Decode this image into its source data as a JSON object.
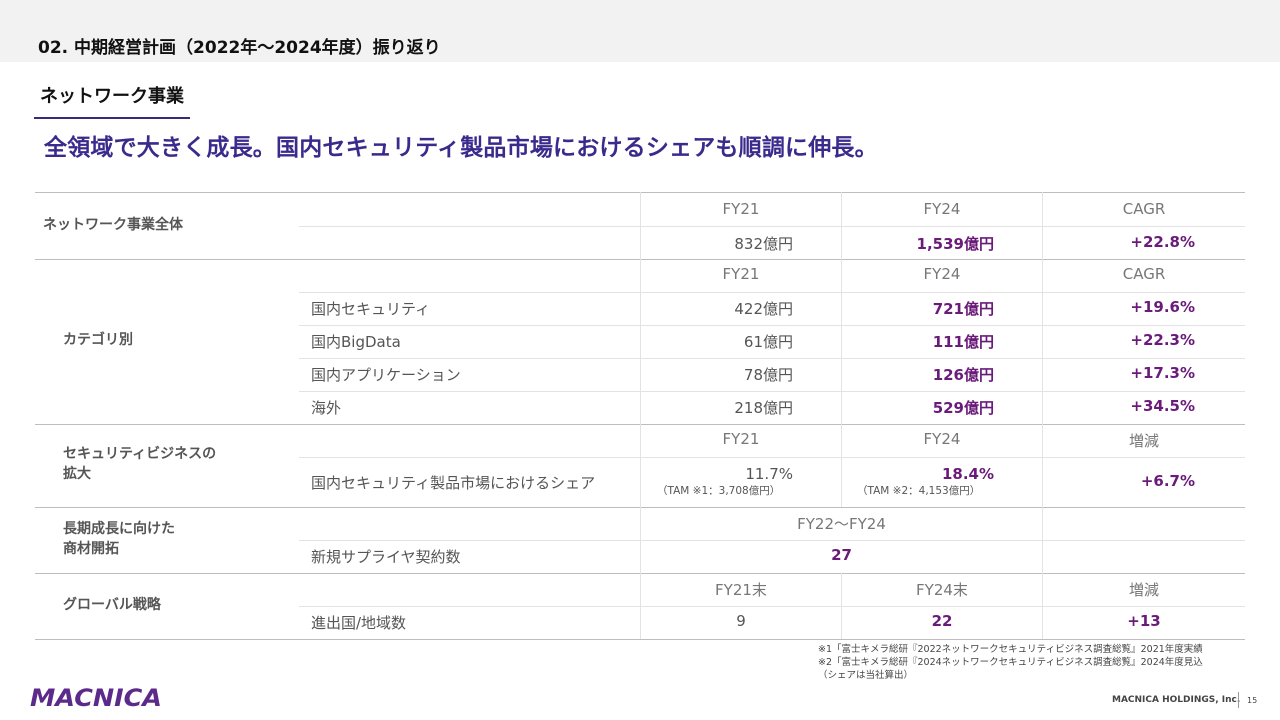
{
  "section_title": "02. 中期経営計画（2022年～2024年度）振り返り",
  "subsection_title": "ネットワーク事業",
  "headline": "全領域で大きく成長。国内セキュリティ製品市場におけるシェアも順調に伸長。",
  "colors": {
    "accent_purple": "#3a2a8c",
    "highlight": "#6a1b7a"
  },
  "table": {
    "overall": {
      "label": "ネットワーク事業全体",
      "headers": [
        "FY21",
        "FY24",
        "CAGR"
      ],
      "row": {
        "fy21": "832億円",
        "fy24": "1,539億円",
        "cagr": "+22.8%"
      }
    },
    "category": {
      "label": "カテゴリ別",
      "headers": [
        "FY21",
        "FY24",
        "CAGR"
      ],
      "rows": [
        {
          "name": "国内セキュリティ",
          "fy21": "422億円",
          "fy24": "721億円",
          "cagr": "+19.6%"
        },
        {
          "name": "国内BigData",
          "fy21": "61億円",
          "fy24": "111億円",
          "cagr": "+22.3%"
        },
        {
          "name": "国内アプリケーション",
          "fy21": "78億円",
          "fy24": "126億円",
          "cagr": "+17.3%"
        },
        {
          "name": "海外",
          "fy21": "218億円",
          "fy24": "529億円",
          "cagr": "+34.5%"
        }
      ]
    },
    "security": {
      "label_line1": "セキュリティビジネスの",
      "label_line2": "拡大",
      "headers": [
        "FY21",
        "FY24",
        "増減"
      ],
      "row": {
        "name": "国内セキュリティ製品市場におけるシェア",
        "fy21": "11.7%",
        "fy21_tam": "（TAM ※1：3,708億円）",
        "fy24": "18.4%",
        "fy24_tam": "（TAM ※2：4,153億円）",
        "change": "+6.7%"
      }
    },
    "products": {
      "label_line1": "長期成長に向けた",
      "label_line2": "商材開拓",
      "header": "FY22～FY24",
      "row": {
        "name": "新規サプライヤ契約数",
        "value": "27"
      }
    },
    "global": {
      "label": "グローバル戦略",
      "headers": [
        "FY21末",
        "FY24末",
        "増減"
      ],
      "row": {
        "name": "進出国/地域数",
        "fy21": "9",
        "fy24": "22",
        "change": "+13"
      }
    }
  },
  "footnotes": [
    "※1「富士キメラ総研『2022ネットワークセキュリティビジネス調査総覧』2021年度実績",
    "※2「富士キメラ総研『2024ネットワークセキュリティビジネス調査総覧』2024年度見込",
    "（シェアは当社算出）"
  ],
  "logo_text": "MACNICA",
  "company": "MACNICA HOLDINGS, Inc.",
  "page_number": "15"
}
